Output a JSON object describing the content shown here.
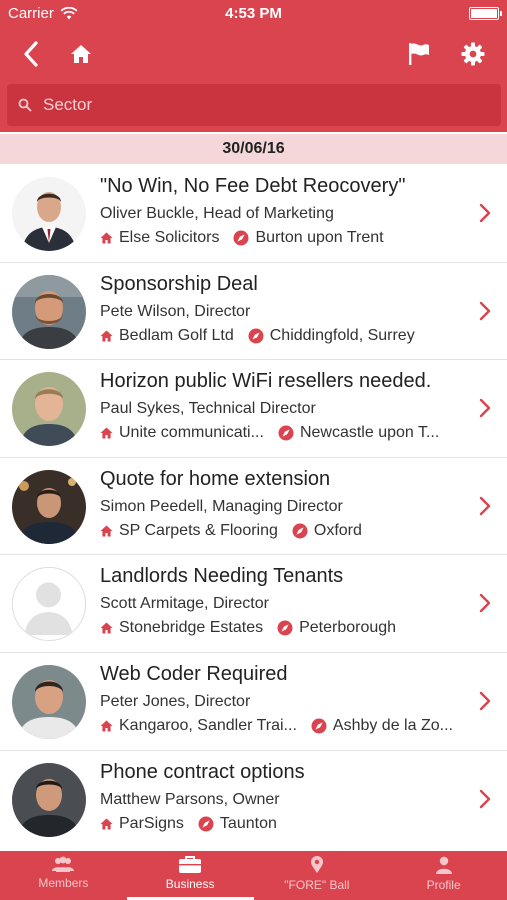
{
  "status_bar": {
    "carrier": "Carrier",
    "time": "4:53 PM"
  },
  "nav": {
    "back_icon": "chevron-left-icon",
    "home_icon": "home-icon",
    "flag_icon": "flag-icon",
    "settings_icon": "gear-icon"
  },
  "search": {
    "placeholder": "Sector",
    "value": ""
  },
  "date_header": "30/06/16",
  "colors": {
    "accent": "#d9444f",
    "search_bg": "#c9343f",
    "date_bg": "#f6d7d9"
  },
  "items": [
    {
      "title": "\"No Win, No Fee Debt Reocovery\"",
      "person": "Oliver Buckle, Head of Marketing",
      "company": "Else Solicitors",
      "location": "Burton upon Trent"
    },
    {
      "title": "Sponsorship Deal",
      "person": "Pete Wilson, Director",
      "company": "Bedlam Golf Ltd",
      "location": "Chiddingfold, Surrey"
    },
    {
      "title": "Horizon public WiFi resellers needed.",
      "person": "Paul Sykes, Technical Director",
      "company": "Unite communicati...",
      "location": "Newcastle upon T..."
    },
    {
      "title": "Quote for home extension",
      "person": "Simon Peedell, Managing Director",
      "company": "SP Carpets & Flooring",
      "location": "Oxford"
    },
    {
      "title": "Landlords Needing Tenants",
      "person": "Scott Armitage, Director",
      "company": "Stonebridge Estates",
      "location": "Peterborough"
    },
    {
      "title": "Web Coder Required",
      "person": "Peter Jones, Director",
      "company": "Kangaroo, Sandler Trai...",
      "location": "Ashby de la Zo..."
    },
    {
      "title": "Phone contract options",
      "person": "Matthew Parsons, Owner",
      "company": "ParSigns",
      "location": "Taunton"
    }
  ],
  "tabs": [
    {
      "label": "Members",
      "icon": "members-icon"
    },
    {
      "label": "Business",
      "icon": "briefcase-icon",
      "active": true
    },
    {
      "label": "\"FORE\" Ball",
      "icon": "location-pin-icon"
    },
    {
      "label": "Profile",
      "icon": "profile-icon"
    }
  ]
}
